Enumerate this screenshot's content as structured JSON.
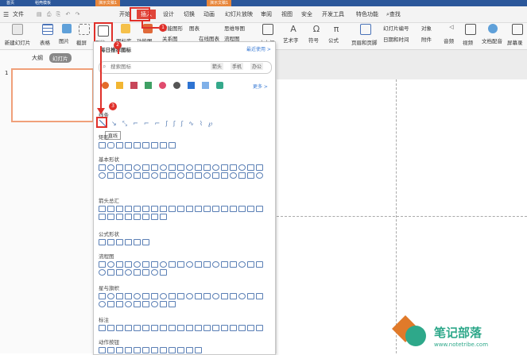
{
  "tabstrip": {
    "tabs": [
      "首页",
      "稻壳模板",
      "演示文稿1",
      "演示文稿1"
    ]
  },
  "menu": {
    "file": "文件",
    "items": [
      "开始",
      "插入",
      "设计",
      "切换",
      "动画",
      "幻灯片放映",
      "审阅",
      "视图",
      "安全",
      "开发工具",
      "特色功能"
    ],
    "search": "查找"
  },
  "ribbon": {
    "new_slide": "新建幻灯片",
    "table": "表格",
    "picture": "图片",
    "screenshot": "截屏",
    "shape": "形状",
    "icon_lib": "图标库",
    "function_chart": "功能图",
    "smart_graphic": "智能图形",
    "chart": "图表",
    "relation": "关系图",
    "online_chart": "在线图表",
    "mindmap": "思维导图",
    "flowchart": "流程图",
    "textbox": "文本框",
    "art_text": "艺术字",
    "symbol": "符号",
    "formula": "公式",
    "header_footer": "页眉和页脚",
    "slide_number": "幻灯片编号",
    "datetime": "日期和时间",
    "object": "对象",
    "attachment": "附件",
    "audio": "音频",
    "video": "视频",
    "doc_voice": "文档配音",
    "screen_record": "屏幕录"
  },
  "leftpanel": {
    "tab_outline": "大纲",
    "tab_slides": "幻灯片",
    "slide_num": "1"
  },
  "shapes_panel": {
    "header": "每日推荐图标",
    "recent": "最近使用 >",
    "search_placeholder": "搜索图标",
    "tags": [
      "箭头",
      "手机",
      "办公"
    ],
    "more": "更多 >",
    "tooltip": "直线",
    "sections": [
      "线条",
      "矩形",
      "基本形状",
      "箭头总汇",
      "公式形状",
      "流程图",
      "星与旗帜",
      "标注",
      "动作按钮"
    ]
  },
  "callouts": {
    "one": "1",
    "two": "2",
    "three": "3"
  },
  "watermark": {
    "text": "笔记部落",
    "url": "www.notetribe.com"
  },
  "colors": {
    "accent": "#e0302a",
    "brand": "#2b579a",
    "shape": "#5a7fb5"
  }
}
